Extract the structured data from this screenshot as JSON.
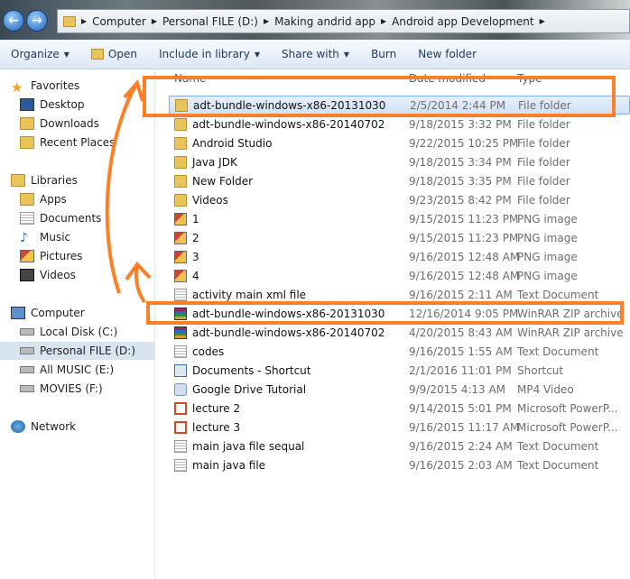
{
  "address": {
    "crumbs": [
      "Computer",
      "Personal FILE (D:)",
      "Making andrid app",
      "Android app Development"
    ]
  },
  "toolbar": {
    "organize": "Organize",
    "open": "Open",
    "include": "Include in library",
    "share": "Share with",
    "burn": "Burn",
    "new_folder": "New folder"
  },
  "sidebar": {
    "favorites": "Favorites",
    "fav_items": [
      "Desktop",
      "Downloads",
      "Recent Places"
    ],
    "libraries": "Libraries",
    "lib_items": [
      "Apps",
      "Documents",
      "Music",
      "Pictures",
      "Videos"
    ],
    "computer": "Computer",
    "drives": [
      "Local Disk (C:)",
      "Personal FILE (D:)",
      "All MUSIC (E:)",
      "MOVIES (F:)"
    ],
    "network": "Network"
  },
  "columns": {
    "name": "Name",
    "date": "Date modified",
    "type": "Type"
  },
  "files": [
    {
      "name": "adt-bundle-windows-x86-20131030",
      "date": "2/5/2014 2:44 PM",
      "type": "File folder",
      "icon": "fold"
    },
    {
      "name": "adt-bundle-windows-x86-20140702",
      "date": "9/18/2015 3:32 PM",
      "type": "File folder",
      "icon": "fold"
    },
    {
      "name": "Android Studio",
      "date": "9/22/2015 10:25 PM",
      "type": "File folder",
      "icon": "fold"
    },
    {
      "name": "Java JDK",
      "date": "9/18/2015 3:34 PM",
      "type": "File folder",
      "icon": "fold"
    },
    {
      "name": "New Folder",
      "date": "9/18/2015 3:35 PM",
      "type": "File folder",
      "icon": "fold"
    },
    {
      "name": "Videos",
      "date": "9/23/2015 8:42 PM",
      "type": "File folder",
      "icon": "fold"
    },
    {
      "name": "1",
      "date": "9/15/2015 11:23 PM",
      "type": "PNG image",
      "icon": "png"
    },
    {
      "name": "2",
      "date": "9/15/2015 11:23 PM",
      "type": "PNG image",
      "icon": "png"
    },
    {
      "name": "3",
      "date": "9/16/2015 12:48 AM",
      "type": "PNG image",
      "icon": "png"
    },
    {
      "name": "4",
      "date": "9/16/2015 12:48 AM",
      "type": "PNG image",
      "icon": "png"
    },
    {
      "name": "activity main xml file",
      "date": "9/16/2015 2:11 AM",
      "type": "Text Document",
      "icon": "txt"
    },
    {
      "name": "adt-bundle-windows-x86-20131030",
      "date": "12/16/2014 9:05 PM",
      "type": "WinRAR ZIP archive",
      "icon": "zip"
    },
    {
      "name": "adt-bundle-windows-x86-20140702",
      "date": "4/20/2015 8:43 AM",
      "type": "WinRAR ZIP archive",
      "icon": "zip"
    },
    {
      "name": "codes",
      "date": "9/16/2015 1:55 AM",
      "type": "Text Document",
      "icon": "txt"
    },
    {
      "name": "Documents - Shortcut",
      "date": "2/1/2016 11:01 PM",
      "type": "Shortcut",
      "icon": "lnk"
    },
    {
      "name": "Google Drive Tutorial",
      "date": "9/9/2015 4:13 AM",
      "type": "MP4 Video",
      "icon": "vid"
    },
    {
      "name": "lecture 2",
      "date": "9/14/2015 5:01 PM",
      "type": "Microsoft PowerP...",
      "icon": "ppt"
    },
    {
      "name": "lecture 3",
      "date": "9/16/2015 11:17 AM",
      "type": "Microsoft PowerP...",
      "icon": "ppt"
    },
    {
      "name": "main java file sequal",
      "date": "9/16/2015 2:24 AM",
      "type": "Text Document",
      "icon": "txt"
    },
    {
      "name": "main java file",
      "date": "9/16/2015 2:03 AM",
      "type": "Text Document",
      "icon": "txt"
    }
  ],
  "annotation_color": "#ff7f27"
}
